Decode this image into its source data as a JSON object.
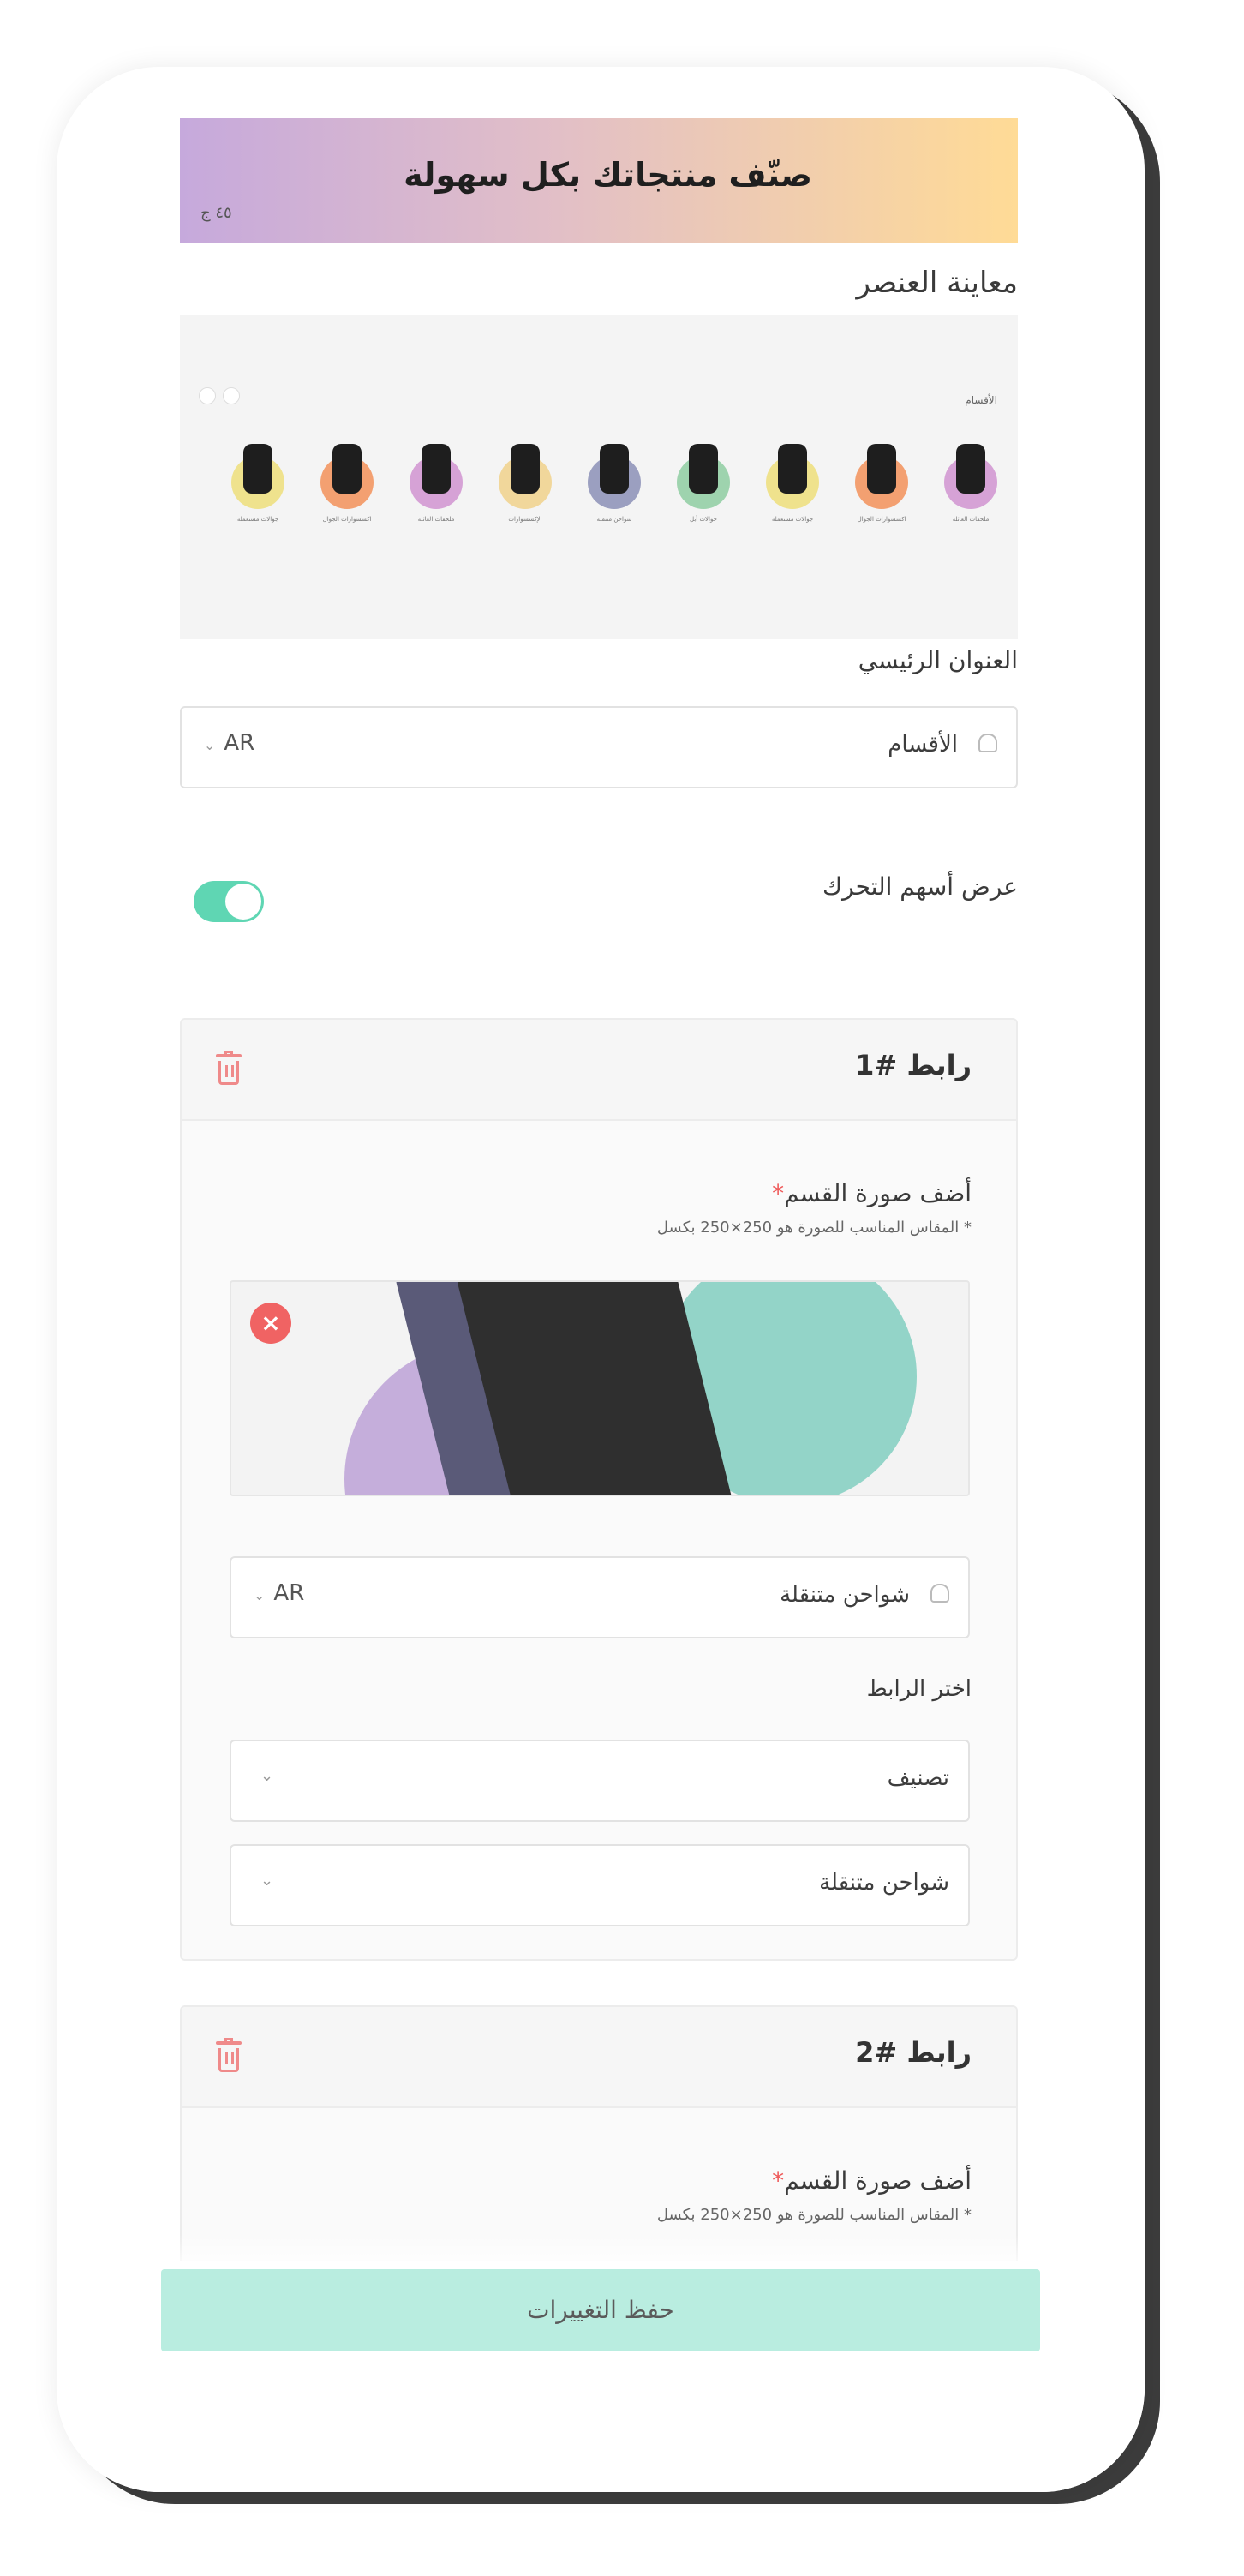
{
  "banner": {
    "title": "صنّف منتجاتك بكل سهولة",
    "tag": "٤٥ ج"
  },
  "preview": {
    "label": "معاينة العنصر",
    "block_title": "الأقسام",
    "items": [
      {
        "color": "#d6a2d6",
        "name": "ملحقات العائلة"
      },
      {
        "color": "#f3a071",
        "name": "اكسسوارات الجوال"
      },
      {
        "color": "#efe28d",
        "name": "جوالات مستعملة"
      },
      {
        "color": "#9ed3ae",
        "name": "جوالات أبل"
      },
      {
        "color": "#9b9fc0",
        "name": "شواحن متنقلة"
      },
      {
        "color": "#f1d79b",
        "name": "الإكسسوارات"
      },
      {
        "color": "#d6a2d6",
        "name": "ملحقات العائلة"
      },
      {
        "color": "#f3a071",
        "name": "اكسسوارات الجوال"
      },
      {
        "color": "#efe28d",
        "name": "جوالات مستعملة"
      }
    ]
  },
  "main_title": {
    "label": "العنوان الرئيسي",
    "value": "الأقسام",
    "lang": "AR"
  },
  "arrows_toggle": {
    "label": "عرض أسهم التحرك",
    "on": true
  },
  "links": [
    {
      "title": "رابط #1",
      "image_label": "أضف صورة القسم",
      "image_hint": "* المقاس المناسب للصورة هو 250×250 بكسل",
      "name_value": "شواحن متنقلة",
      "lang": "AR",
      "choose_link_label": "اختر الرابط",
      "link_type": "تصنيف",
      "link_target": "شواحن متنقلة"
    },
    {
      "title": "رابط #2",
      "image_label": "أضف صورة القسم",
      "image_hint": "* المقاس المناسب للصورة هو 250×250 بكسل"
    }
  ],
  "save_button": "حفظ التغييرات",
  "colors": {
    "accent": "#5fd6b3",
    "save_bg": "#b9ede0",
    "danger": "#ef5b5b"
  }
}
